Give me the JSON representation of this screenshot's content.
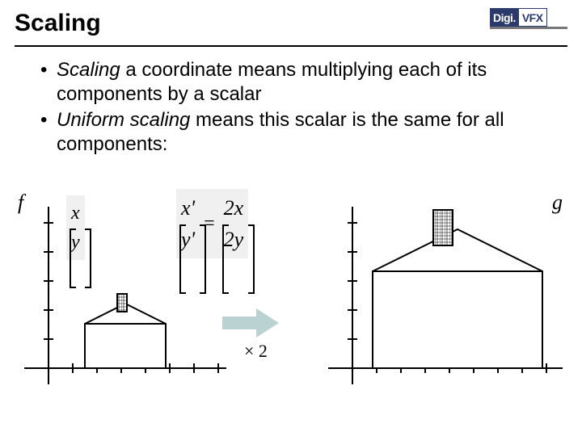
{
  "title": "Scaling",
  "logo": {
    "left": "Digi.",
    "right": "VFX"
  },
  "bullets": {
    "b1_em": "Scaling",
    "b1_rest": " a coordinate means multiplying each of its components by a scalar",
    "b2_em": "Uniform scaling",
    "b2_rest": " means this scalar is the same for all components:"
  },
  "labels": {
    "f": "f",
    "g": "g",
    "times": "× 2"
  },
  "matrix": {
    "in_top": "x",
    "in_bot": "y",
    "out_top": "x'",
    "out_bot": "y'",
    "res_top": "2x",
    "res_bot": "2y",
    "eq": "="
  }
}
